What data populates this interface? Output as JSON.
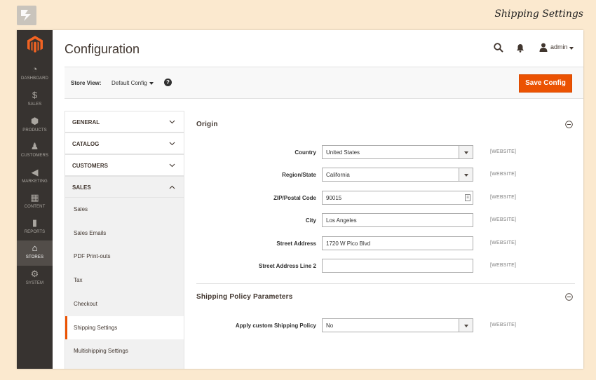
{
  "banner": {
    "title": "Shipping Settings"
  },
  "sidebar": {
    "items": [
      {
        "label": "DASHBOARD",
        "icon": "dashboard-icon",
        "glyph": "◔"
      },
      {
        "label": "SALES",
        "icon": "dollar-icon",
        "glyph": "$"
      },
      {
        "label": "PRODUCTS",
        "icon": "cube-icon",
        "glyph": "⬢"
      },
      {
        "label": "CUSTOMERS",
        "icon": "person-icon",
        "glyph": "♟"
      },
      {
        "label": "MARKETING",
        "icon": "megaphone-icon",
        "glyph": "◀"
      },
      {
        "label": "CONTENT",
        "icon": "content-icon",
        "glyph": "▦"
      },
      {
        "label": "REPORTS",
        "icon": "bar-chart-icon",
        "glyph": "▮"
      },
      {
        "label": "STORES",
        "icon": "store-icon",
        "glyph": "⌂"
      },
      {
        "label": "SYSTEM",
        "icon": "gear-icon",
        "glyph": "⚙"
      }
    ],
    "active": "STORES"
  },
  "header": {
    "title": "Configuration",
    "user": "admin"
  },
  "storebar": {
    "label": "Store View:",
    "value": "Default Config",
    "help": "?",
    "save_label": "Save Config"
  },
  "tabs": {
    "groups": [
      {
        "label": "GENERAL",
        "open": false
      },
      {
        "label": "CATALOG",
        "open": false
      },
      {
        "label": "CUSTOMERS",
        "open": false
      },
      {
        "label": "SALES",
        "open": true
      }
    ],
    "sales_items": [
      "Sales",
      "Sales Emails",
      "PDF Print-outs",
      "Tax",
      "Checkout",
      "Shipping Settings",
      "Multishipping Settings"
    ],
    "active_item": "Shipping Settings"
  },
  "origin": {
    "title": "Origin",
    "fields": [
      {
        "label": "Country",
        "value": "United States",
        "type": "select",
        "scope": "[WEBSITE]"
      },
      {
        "label": "Region/State",
        "value": "California",
        "type": "select",
        "scope": "[WEBSITE]"
      },
      {
        "label": "ZIP/Postal Code",
        "value": "90015",
        "type": "text",
        "scope": "[WEBSITE]"
      },
      {
        "label": "City",
        "value": "Los Angeles",
        "type": "text",
        "scope": "[WEBSITE]"
      },
      {
        "label": "Street Address",
        "value": "1720 W Pico Blvd",
        "type": "text",
        "scope": "[WEBSITE]"
      },
      {
        "label": "Street Address Line 2",
        "value": "",
        "type": "text",
        "scope": "[WEBSITE]"
      }
    ]
  },
  "shipping_policy": {
    "title": "Shipping Policy Parameters",
    "fields": [
      {
        "label": "Apply custom Shipping Policy",
        "value": "No",
        "type": "select",
        "scope": "[WEBSITE]"
      }
    ]
  },
  "colors": {
    "accent": "#eb5202",
    "sidebar": "#373330",
    "page_bg": "#fbe9cf"
  }
}
